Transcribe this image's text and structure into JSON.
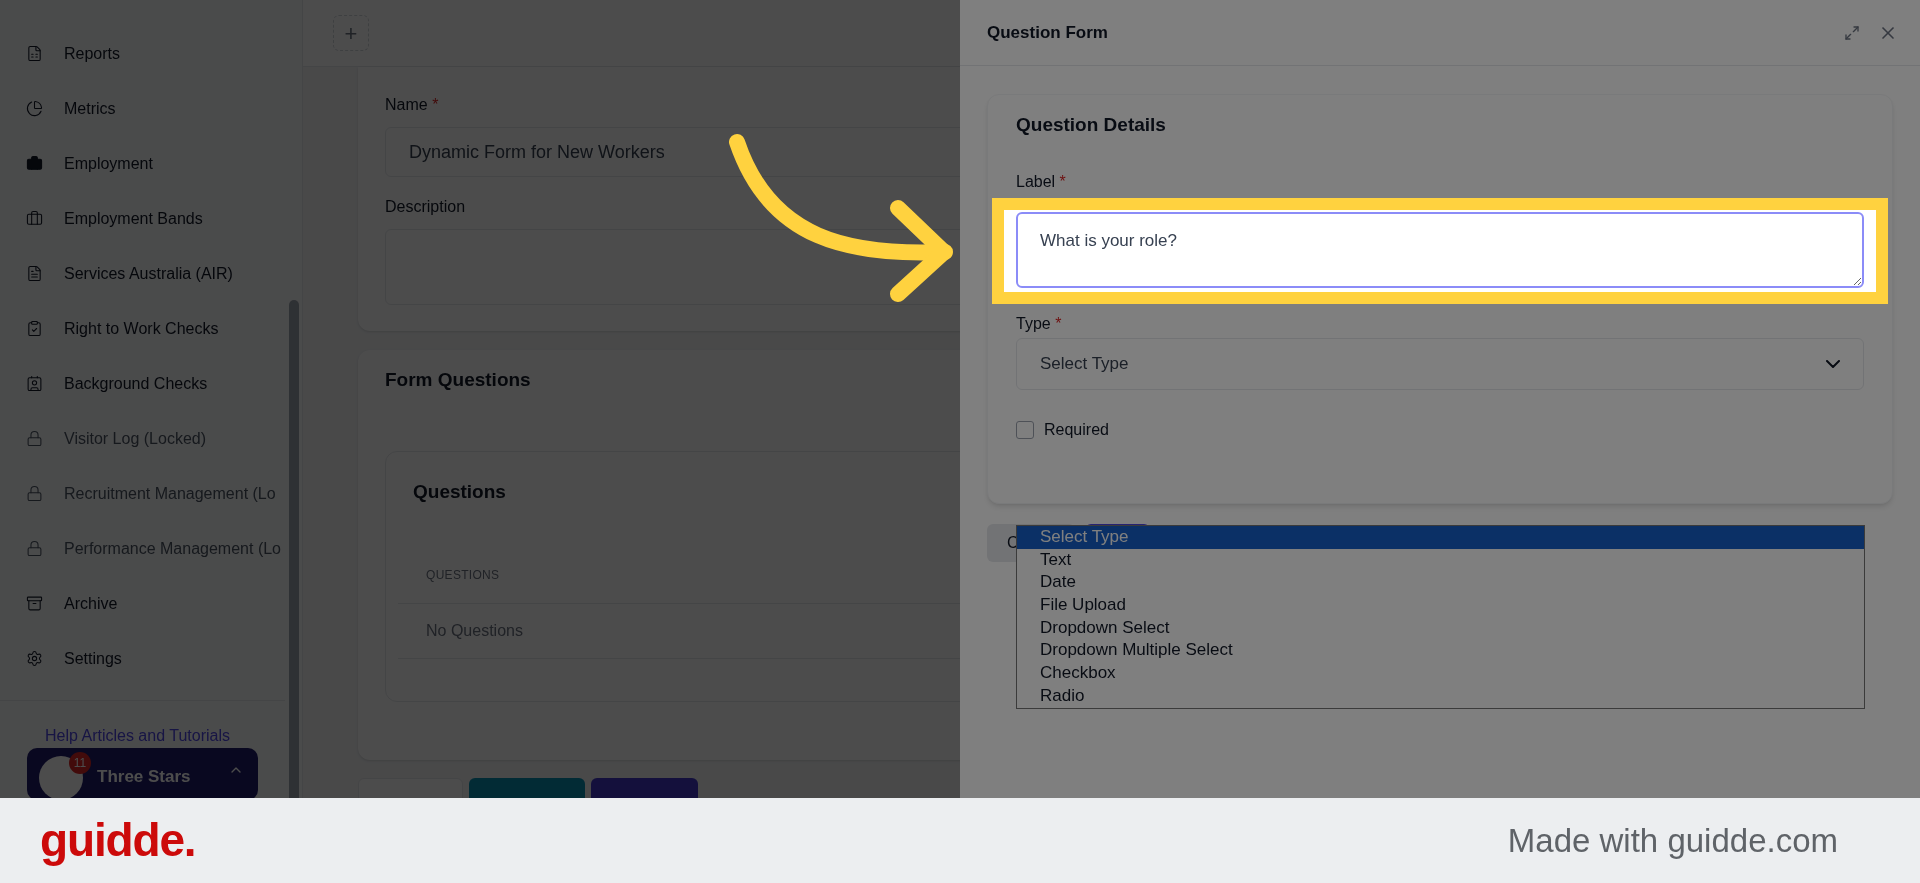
{
  "sidebar": {
    "items": [
      {
        "label": "Reports",
        "locked": false
      },
      {
        "label": "Metrics",
        "locked": false
      },
      {
        "label": "Employment",
        "locked": false
      },
      {
        "label": "Employment Bands",
        "locked": false
      },
      {
        "label": "Services Australia (AIR)",
        "locked": false
      },
      {
        "label": "Right to Work Checks",
        "locked": false
      },
      {
        "label": "Background Checks",
        "locked": false
      },
      {
        "label": "Visitor Log (Locked)",
        "locked": true
      },
      {
        "label": "Recruitment Management (Lo",
        "locked": true
      },
      {
        "label": "Performance Management (Lo",
        "locked": true
      },
      {
        "label": "Archive",
        "locked": false
      },
      {
        "label": "Settings",
        "locked": false
      }
    ],
    "help_link": "Help Articles and Tutorials",
    "account": {
      "name": "Three Stars",
      "badge": "11"
    }
  },
  "toolbar": {
    "add_button": "+"
  },
  "form": {
    "name_label": "Name",
    "name_mark": "*",
    "name_value": "Dynamic Form for New Workers",
    "description_label": "Description"
  },
  "questions_section": {
    "title": "Form Questions",
    "card_title": "Questions",
    "column": "QUESTIONS",
    "empty_text": "No Questions"
  },
  "drawer": {
    "title": "Question Form",
    "card_title": "Question Details",
    "label_field": {
      "label": "Label",
      "mark": "*",
      "value": "What is your role?"
    },
    "type_field": {
      "label": "Type",
      "mark": "*",
      "value": "Select Type",
      "options": [
        {
          "label": "Select Type",
          "selected": true
        },
        {
          "label": "Text",
          "selected": false
        },
        {
          "label": "Date",
          "selected": false
        },
        {
          "label": "File Upload",
          "selected": false
        },
        {
          "label": "Dropdown Select",
          "selected": false
        },
        {
          "label": "Dropdown Multiple Select",
          "selected": false
        },
        {
          "label": "Checkbox",
          "selected": false
        },
        {
          "label": "Radio",
          "selected": false
        }
      ]
    },
    "required": {
      "label": "Required",
      "checked": false
    },
    "cancel_button": "C"
  },
  "banner": {
    "logo": "guidde.",
    "text": "Made with guidde.com"
  }
}
